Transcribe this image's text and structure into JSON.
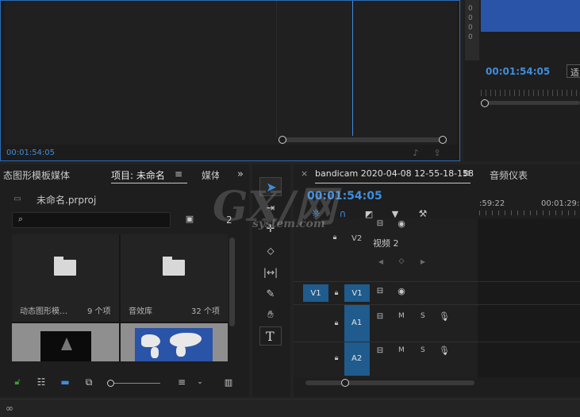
{
  "source_monitor": {
    "timecode": "00:01:54:05"
  },
  "program_monitor": {
    "timecode": "00:01:54:05",
    "fit_label": "适",
    "meter_ticks": [
      "0",
      "0",
      "0",
      "0"
    ]
  },
  "project_panel": {
    "tabs": [
      "态图形模板媒体",
      "项目: 未命名",
      "媒体"
    ],
    "project_file": "未命名.prproj",
    "search_placeholder": "",
    "count_label": "2",
    "bins": [
      {
        "name": "动态图形模…",
        "count": "9 个项"
      },
      {
        "name": "音效库",
        "count": "32 个项"
      }
    ]
  },
  "tools": {
    "type_tool": "T"
  },
  "timeline": {
    "close": "×",
    "sequence_name": "bandicam 2020-04-08 12-55-18-158",
    "menu_icon": "≡",
    "audio_meter_tab": "音频仪表",
    "timecode": "00:01:54:05",
    "ruler_labels": [
      ":59:22",
      "00:01:29:2"
    ],
    "tracks": {
      "v2": "V2",
      "v2_name": "视频 2",
      "v1_source": "V1",
      "v1": "V1",
      "a1": "A1",
      "a2": "A2",
      "mute": "M",
      "solo": "S"
    }
  },
  "watermark": {
    "text_big": "GX/网",
    "text_small": "system.com"
  },
  "colors": {
    "accent": "#3f8ddb",
    "track_blue": "#1f5b8c",
    "thumb_blue": "#2a54a8"
  }
}
